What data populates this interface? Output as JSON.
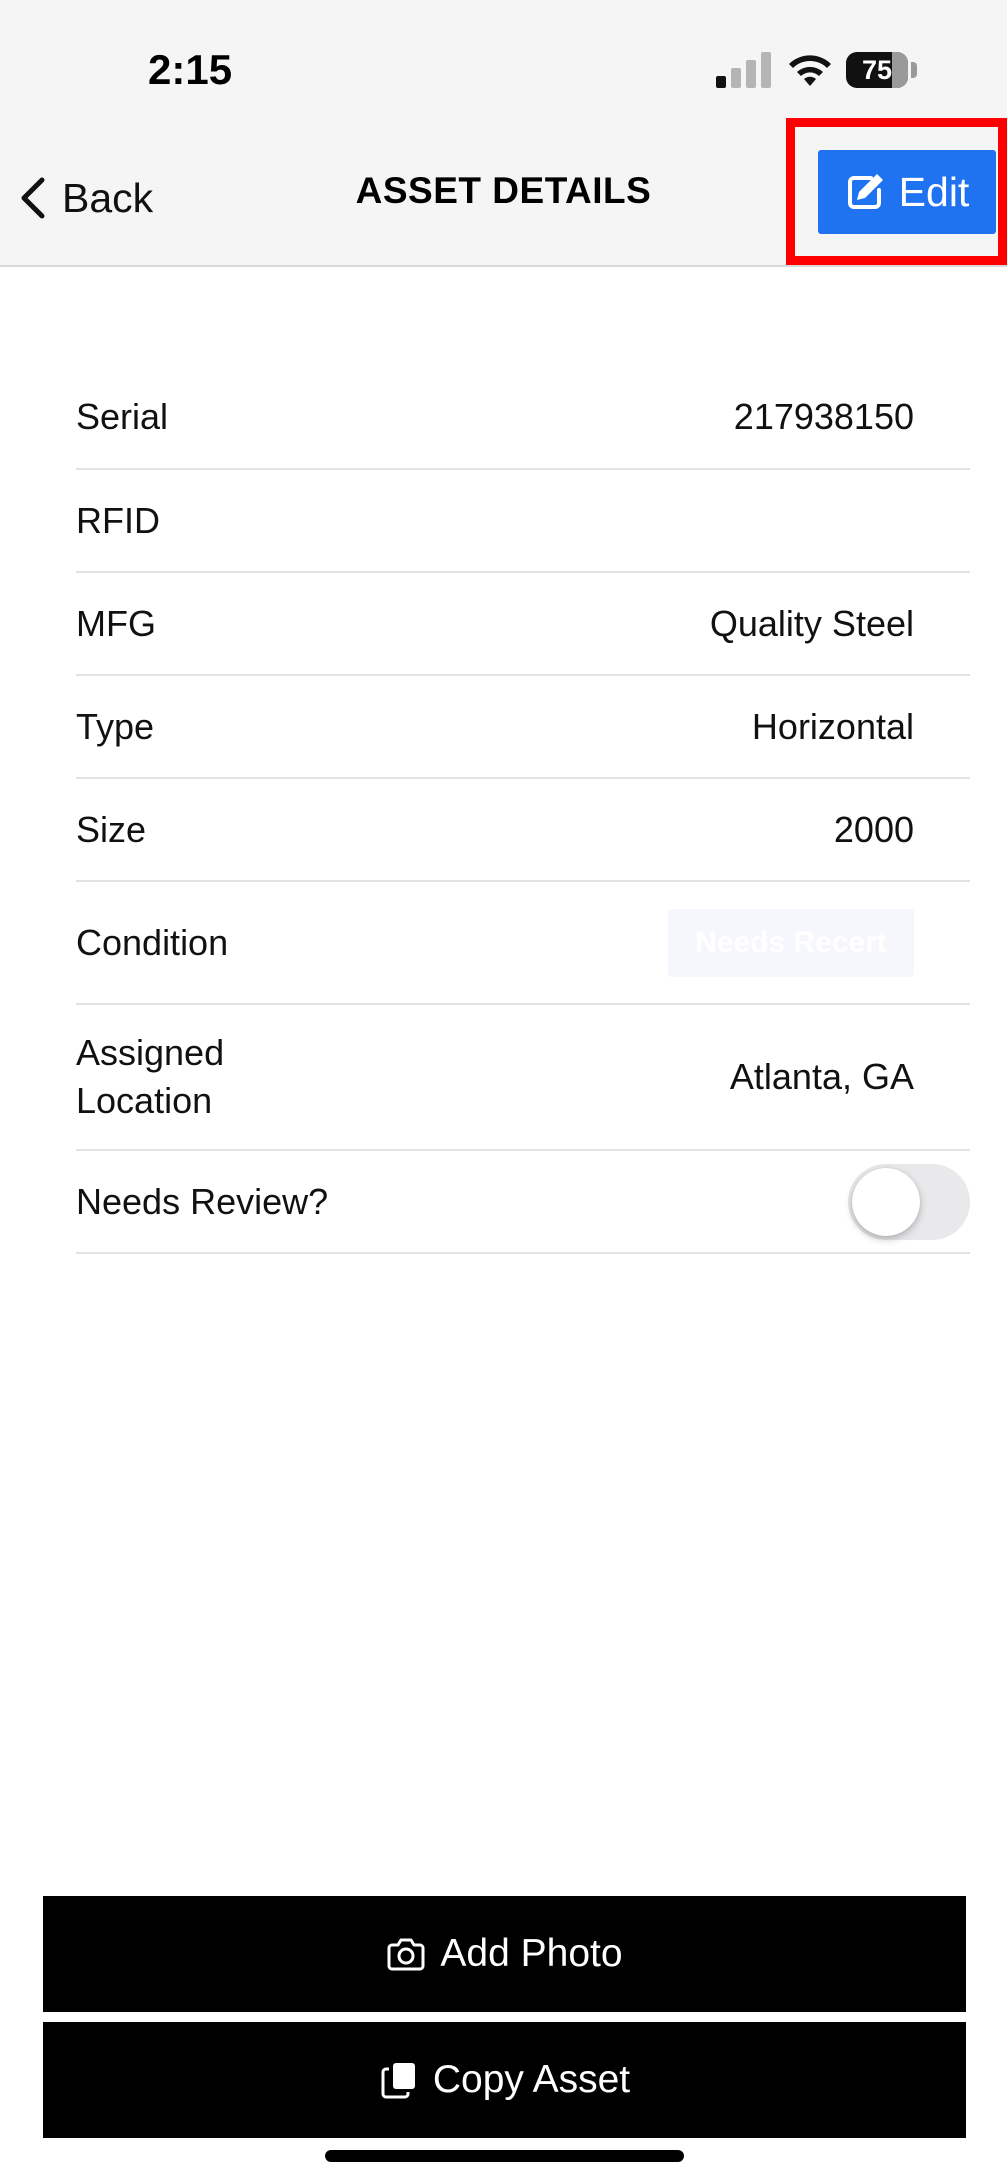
{
  "status_bar": {
    "time": "2:15",
    "battery_level": "75"
  },
  "nav": {
    "back_label": "Back",
    "title": "ASSET DETAILS",
    "edit_label": "Edit",
    "edit_icon": "edit-square-icon",
    "accent_color": "#1f73f1",
    "highlight_color": "#ff0000"
  },
  "details": {
    "serial_label": "Serial",
    "serial_value": "217938150",
    "rfid_label": "RFID",
    "rfid_value": "",
    "mfg_label": "MFG",
    "mfg_value": "Quality Steel",
    "type_label": "Type",
    "type_value": "Horizontal",
    "size_label": "Size",
    "size_value": "2000",
    "condition_label": "Condition",
    "condition_value": "Needs Recert",
    "location_label_line1": "Assigned",
    "location_label_line2": "Location",
    "location_value": "Atlanta, GA",
    "review_label": "Needs Review?",
    "review_on": false
  },
  "actions": {
    "add_photo_label": "Add Photo",
    "add_photo_icon": "camera-icon",
    "copy_asset_label": "Copy Asset",
    "copy_asset_icon": "copy-icon"
  }
}
